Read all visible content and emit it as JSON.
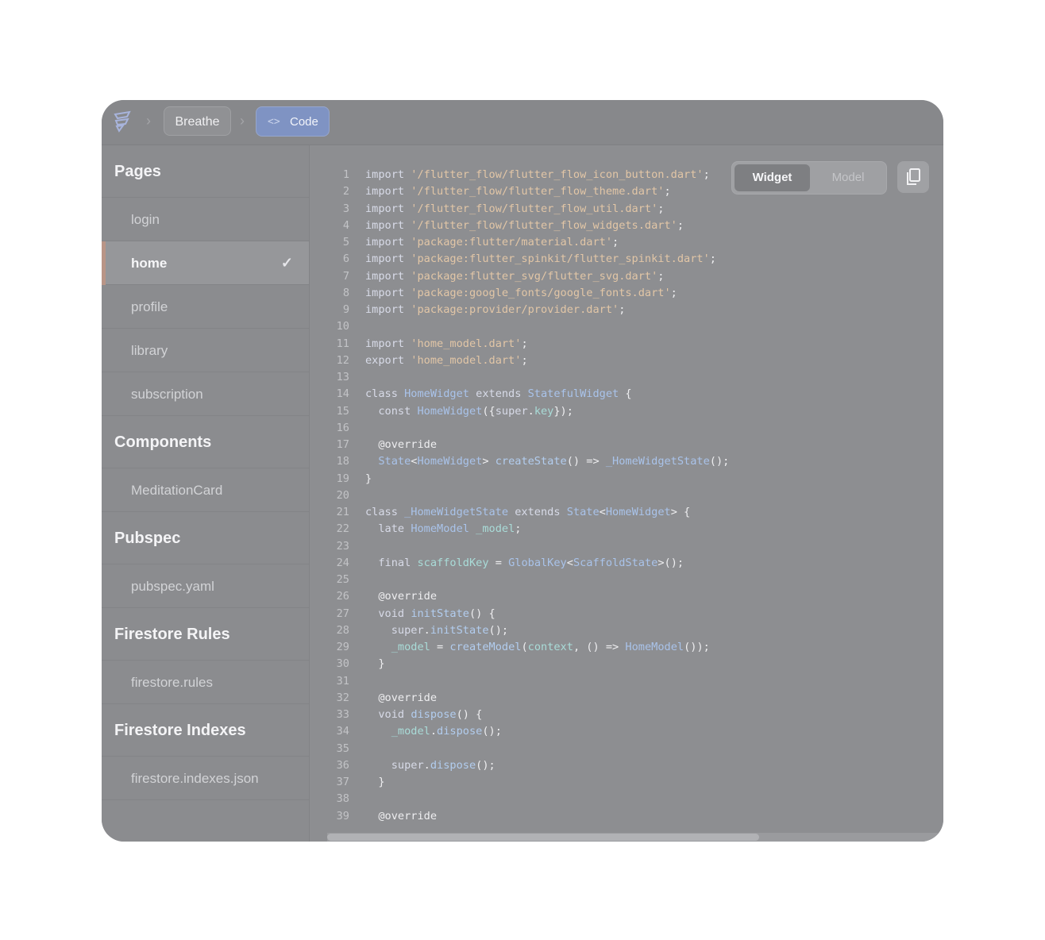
{
  "breadcrumb": {
    "project": "Breathe",
    "current": "Code",
    "current_icon": "code-brackets-icon",
    "logo_icon": "flutterflow-logo-icon",
    "separator": "›"
  },
  "sidebar": {
    "sections": [
      {
        "title": "Pages",
        "items": [
          "login",
          "home",
          "profile",
          "library",
          "subscription"
        ]
      },
      {
        "title": "Components",
        "items": [
          "MeditationCard"
        ]
      },
      {
        "title": "Pubspec",
        "items": [
          "pubspec.yaml"
        ]
      },
      {
        "title": "Firestore Rules",
        "items": [
          "firestore.rules"
        ]
      },
      {
        "title": "Firestore Indexes",
        "items": [
          "firestore.indexes.json"
        ]
      }
    ],
    "selected_item": "home",
    "selected_icon": "checkmark-icon",
    "check_glyph": "✓"
  },
  "code_view": {
    "toggle": {
      "widget": "Widget",
      "model": "Model",
      "selected": "Widget"
    },
    "copy_icon": "copy-icon",
    "lines": [
      "import '/flutter_flow/flutter_flow_icon_button.dart';",
      "import '/flutter_flow/flutter_flow_theme.dart';",
      "import '/flutter_flow/flutter_flow_util.dart';",
      "import '/flutter_flow/flutter_flow_widgets.dart';",
      "import 'package:flutter/material.dart';",
      "import 'package:flutter_spinkit/flutter_spinkit.dart';",
      "import 'package:flutter_svg/flutter_svg.dart';",
      "import 'package:google_fonts/google_fonts.dart';",
      "import 'package:provider/provider.dart';",
      "",
      "import 'home_model.dart';",
      "export 'home_model.dart';",
      "",
      "class HomeWidget extends StatefulWidget {",
      "  const HomeWidget({super.key});",
      "",
      "  @override",
      "  State<HomeWidget> createState() => _HomeWidgetState();",
      "}",
      "",
      "class _HomeWidgetState extends State<HomeWidget> {",
      "  late HomeModel _model;",
      "",
      "  final scaffoldKey = GlobalKey<ScaffoldState>();",
      "",
      "  @override",
      "  void initState() {",
      "    super.initState();",
      "    _model = createModel(context, () => HomeModel());",
      "  }",
      "",
      "  @override",
      "  void dispose() {",
      "    _model.dispose();",
      "",
      "    super.dispose();",
      "  }",
      "",
      "  @override"
    ]
  },
  "colors": {
    "accent": "#7f93c3",
    "active_indicator": "#b99587",
    "string": "#e2c6a6",
    "type": "#a9c3ea"
  }
}
